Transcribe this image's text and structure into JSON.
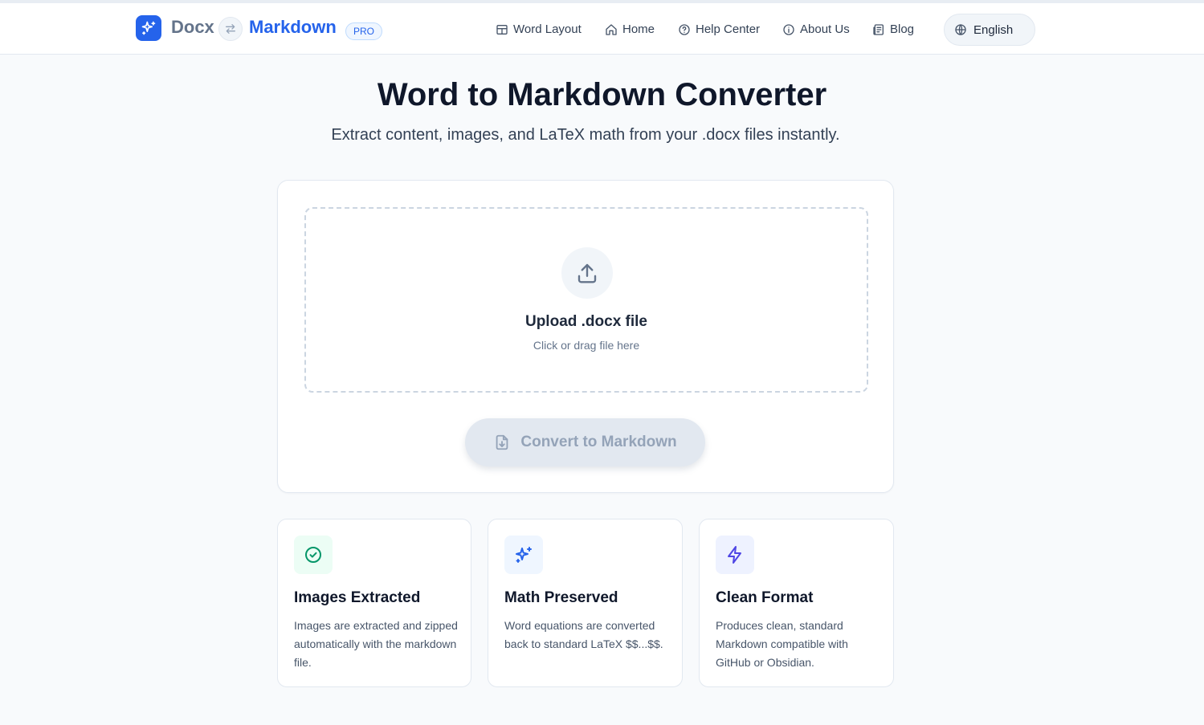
{
  "header": {
    "brand_left": "Docx",
    "brand_right": "Markdown",
    "badge": "PRO",
    "nav": [
      {
        "label": "Word Layout",
        "icon": "layout-icon"
      },
      {
        "label": "Home",
        "icon": "home-icon"
      },
      {
        "label": "Help Center",
        "icon": "help-circle-icon"
      },
      {
        "label": "About Us",
        "icon": "info-icon"
      },
      {
        "label": "Blog",
        "icon": "newspaper-icon"
      }
    ],
    "language": "English"
  },
  "hero": {
    "title": "Word to Markdown Converter",
    "subtitle": "Extract content, images, and LaTeX math from your .docx files instantly."
  },
  "upload": {
    "title": "Upload .docx file",
    "hint": "Click or drag file here",
    "convert_label": "Convert to Markdown"
  },
  "features": [
    {
      "title": "Images Extracted",
      "description": "Images are extracted and zipped automatically with the markdown file.",
      "icon": "check-circle-icon"
    },
    {
      "title": "Math Preserved",
      "description": "Word equations are converted back to standard LaTeX $$...$$.",
      "icon": "sparkles-icon"
    },
    {
      "title": "Clean Format",
      "description": "Produces clean, standard Markdown compatible with GitHub or Obsidian.",
      "icon": "zap-icon"
    }
  ],
  "colors": {
    "primary": "#2563eb",
    "feature_green_bg": "#ecfdf5",
    "feature_green": "#059669",
    "feature_blue_bg": "#eff6ff",
    "feature_indigo_bg": "#eef2ff",
    "feature_indigo": "#4f46e5"
  }
}
